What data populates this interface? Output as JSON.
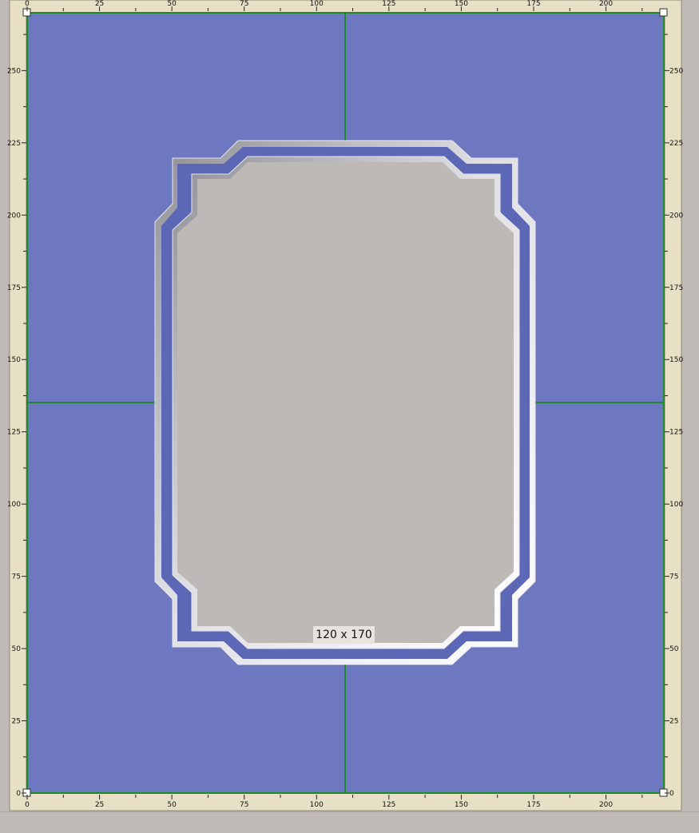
{
  "colors": {
    "ruler_background": "#e8e0c4",
    "mat_color": "#6e78c0",
    "frame_line": "#1a8a2a",
    "opening_fill": "#bdb9b6",
    "bevel_light": "#ffffff",
    "bevel_mid": "#c9c9cf",
    "workspace_bg": "#bfbab6"
  },
  "rulers": {
    "horizontal_ticks": [
      "0",
      "25",
      "50",
      "75",
      "100",
      "125",
      "150",
      "175",
      "200"
    ],
    "vertical_ticks": [
      "250",
      "225",
      "200",
      "175",
      "150",
      "125",
      "100",
      "75",
      "50",
      "25",
      "0"
    ],
    "x_range_mm": [
      0,
      220
    ],
    "y_range_mm": [
      0,
      270
    ]
  },
  "mat": {
    "opening_size_label": "120 x 170"
  }
}
